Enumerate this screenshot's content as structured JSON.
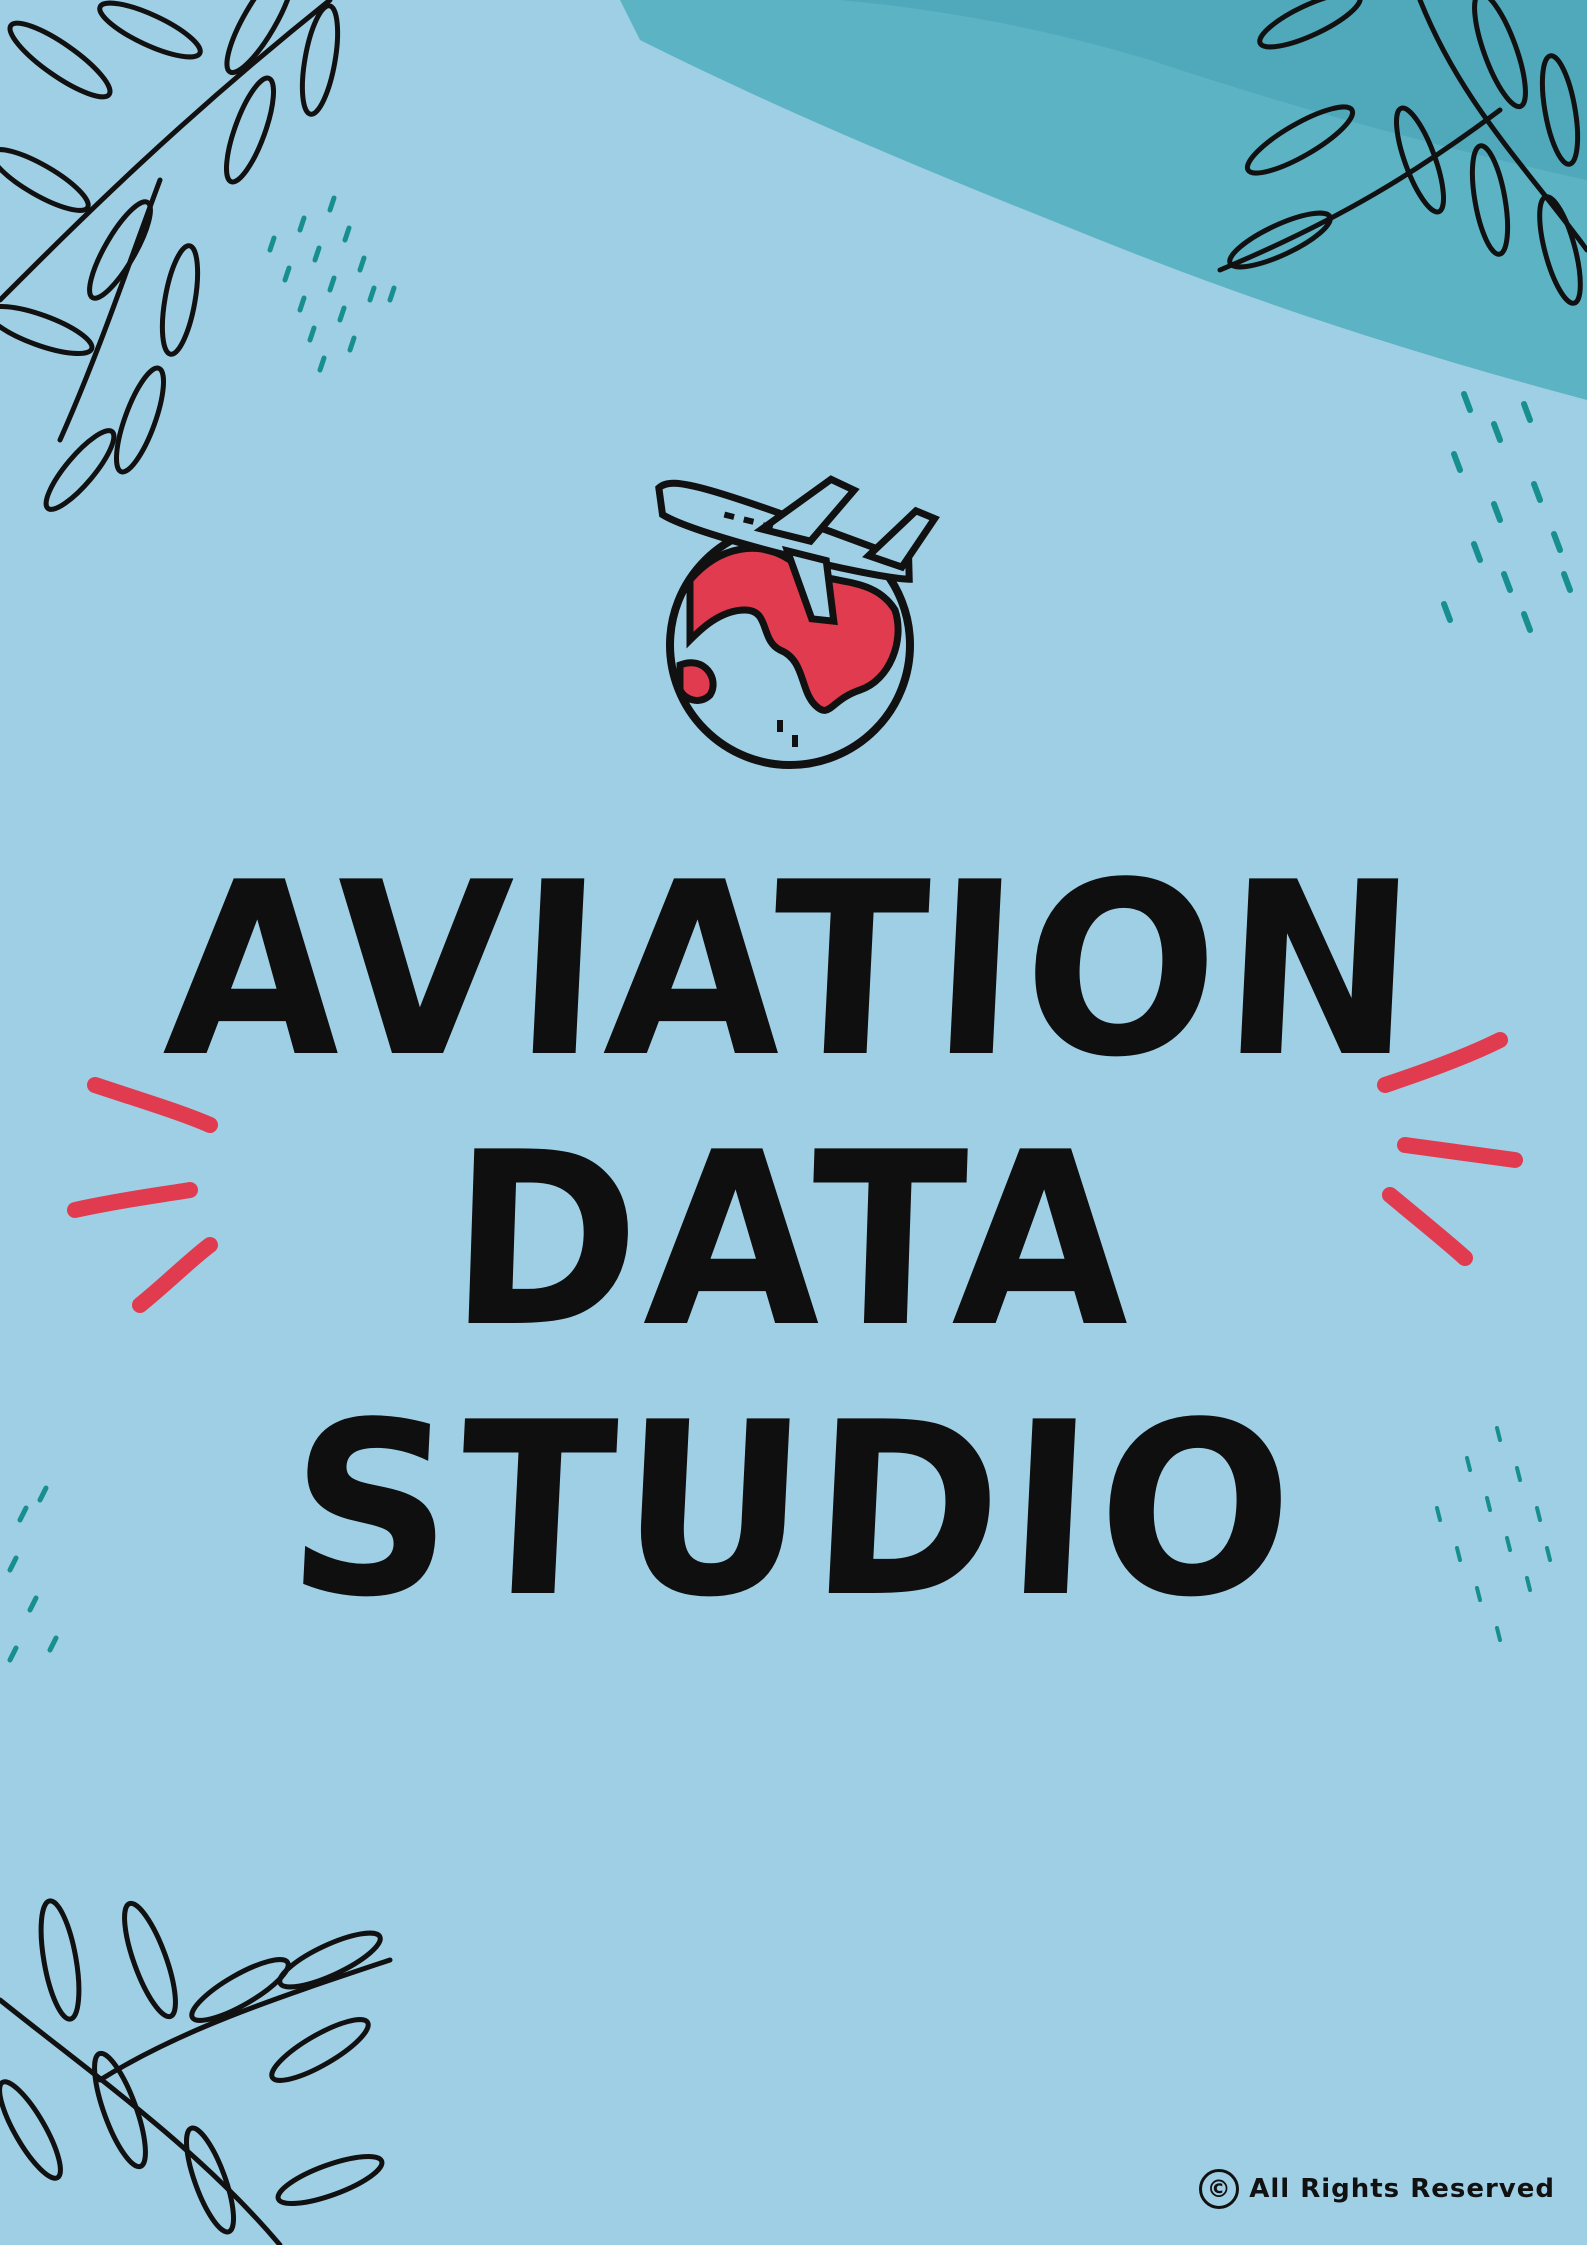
{
  "poster": {
    "title_lines": [
      "AVIATION",
      "DATA",
      "STUDIO"
    ],
    "icon": "plane-globe-icon",
    "footer_symbol": "©",
    "footer_text": "All Rights Reserved"
  },
  "colors": {
    "background": "#9ecfe4",
    "teal_stroke": "#5bb3c3",
    "accent_red": "#e03b4f",
    "ink": "#0f0f0f",
    "dot_teal": "#178e8f"
  }
}
